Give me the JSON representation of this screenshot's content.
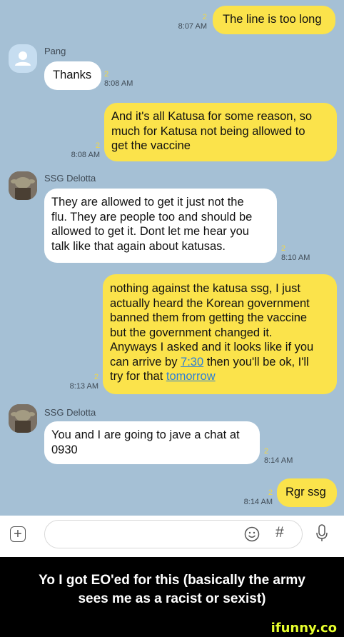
{
  "messages": [
    {
      "text": "The line is too long",
      "time": "8:07 AM",
      "count": "2"
    },
    {
      "sender": "Pang",
      "text": "Thanks",
      "time": "8:08 AM",
      "count": "2"
    },
    {
      "text": "And it's all Katusa for some reason, so\nmuch for Katusa not being allowed to\nget the vaccine",
      "time": "8:08 AM",
      "count": "2"
    },
    {
      "sender": "SSG Delotta",
      "text": "They are allowed to get it just not the\nflu. They are people too and should be\nallowed to get it. Dont let me hear you\ntalk like that again about katusas.",
      "time": "8:10 AM",
      "count": "2"
    },
    {
      "text_before": "nothing against the katusa ssg, I just\nactually heard the Korean government\nbanned them from getting the vaccine\nbut the government changed it.\nAnyways I asked and it looks like if you\ncan arrive by ",
      "link1": "7:30",
      "text_mid": " then you'll be ok, I'll\ntry for that ",
      "link2": "tomorrow",
      "time": "8:13 AM",
      "count": "2"
    },
    {
      "sender": "SSG Delotta",
      "text": "You and I are going to jave a chat at\n0930",
      "time": "8:14 AM",
      "count": "2"
    },
    {
      "text": "Rgr ssg",
      "time": "8:14 AM",
      "count": "2"
    }
  ],
  "composer": {
    "plus_icon": "plus-icon",
    "emoji_icon": "emoji-icon",
    "hash_icon": "hash-icon",
    "mic_icon": "mic-icon"
  },
  "caption": "Yo I got EO'ed for this (basically the army\nsees me as a racist or sexist)",
  "brand": "ifunny.co",
  "colors": {
    "chat_bg": "#a5c0d5",
    "mine": "#fbe34b",
    "theirs": "#ffffff",
    "unread": "#f1d648",
    "link": "#2d7fd6"
  }
}
